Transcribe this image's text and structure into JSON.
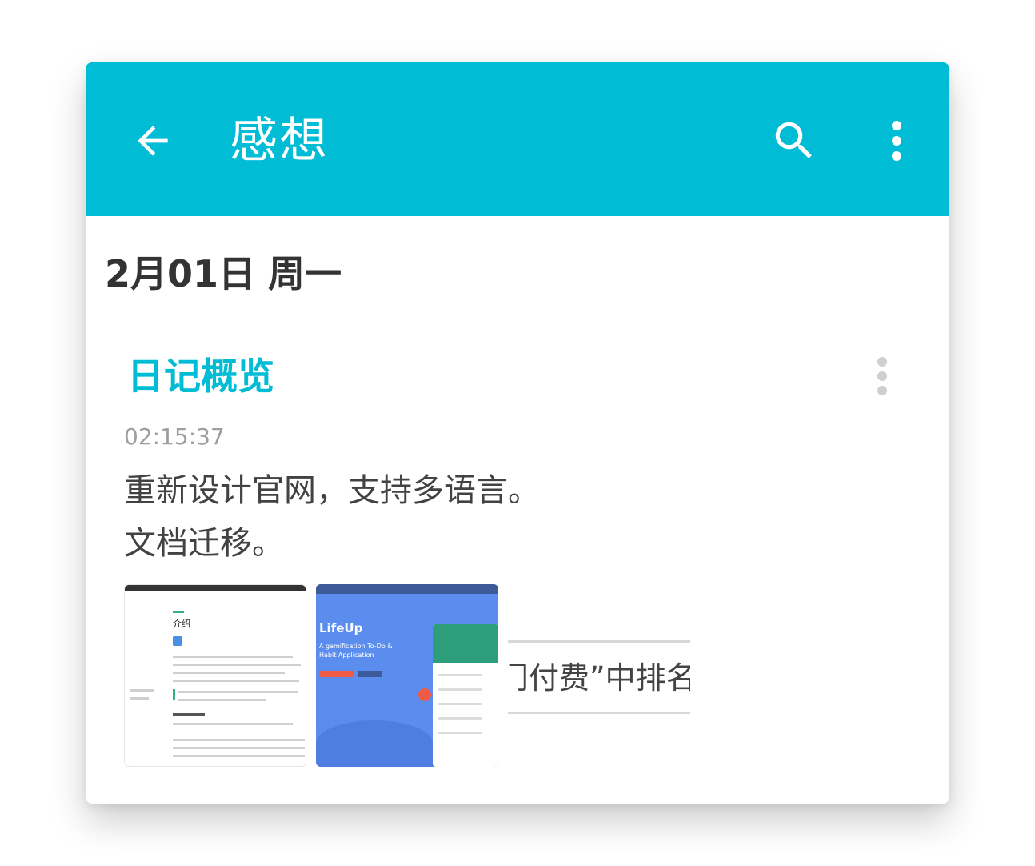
{
  "toolbar": {
    "title": "感想",
    "back_icon": "arrow-back-icon",
    "search_icon": "search-icon",
    "more_icon": "more-vert-icon",
    "color": "#00bcd4"
  },
  "date_group": {
    "label": "2月01日 周一"
  },
  "entry": {
    "title": "日记概览",
    "time": "02:15:37",
    "content": "重新设计官网，支持多语言。\n文档迁移。",
    "more_icon": "more-vert-icon",
    "accent_color": "#00bcd4"
  },
  "attachments": {
    "thumb1": {
      "heading": "介绍"
    },
    "thumb2": {
      "title": "LifeUp",
      "subtitle": "A gamification To-Do & Habit Application"
    },
    "thumb3": {
      "text": "门付费”中排名"
    }
  }
}
